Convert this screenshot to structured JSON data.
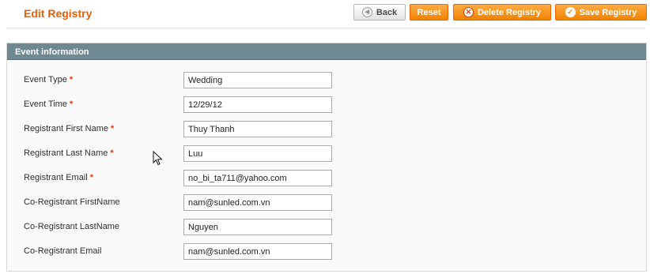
{
  "page": {
    "title": "Edit Registry"
  },
  "toolbar": {
    "back_label": "Back",
    "reset_label": "Reset",
    "delete_label": "Delete Registry",
    "save_label": "Save Registry"
  },
  "section": {
    "title": "Event information",
    "fields": [
      {
        "label": "Event Type",
        "required": "*",
        "value": "Wedding"
      },
      {
        "label": "Event Time",
        "required": "*",
        "value": "12/29/12"
      },
      {
        "label": "Registrant First Name",
        "required": "*",
        "value": "Thuy Thanh"
      },
      {
        "label": "Registrant Last Name",
        "required": "*",
        "value": "Luu"
      },
      {
        "label": "Registrant Email",
        "required": "*",
        "value": "no_bi_ta711@yahoo.com"
      },
      {
        "label": "Co-Registrant FirstName",
        "required": "",
        "value": "nam@sunled.com.vn"
      },
      {
        "label": "Co-Registrant LastName",
        "required": "",
        "value": "Nguyen"
      },
      {
        "label": "Co-Registrant Email",
        "required": "",
        "value": "nam@sunled.com.vn"
      }
    ]
  },
  "colors": {
    "title": "#eb5e00",
    "button_orange": "#f18200",
    "section_header": "#6f8992",
    "required_star": "#eb340a"
  }
}
